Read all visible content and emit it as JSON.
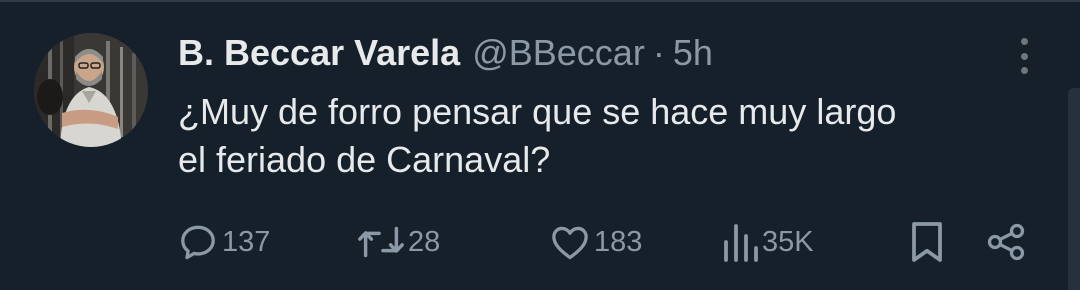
{
  "tweet": {
    "display_name": "B. Beccar Varela",
    "handle": "@BBeccar",
    "separator": "·",
    "time": "5h",
    "text_lines": [
      "¿Muy de forro pensar que se hace muy largo",
      "el feriado de Carnaval?"
    ]
  },
  "actions": {
    "reply": {
      "icon": "reply-icon",
      "count": "137"
    },
    "retweet": {
      "icon": "retweet-icon",
      "count": "28"
    },
    "like": {
      "icon": "heart-icon",
      "count": "183"
    },
    "views": {
      "icon": "views-icon",
      "count": "35K"
    },
    "bookmark": {
      "icon": "bookmark-icon"
    },
    "share": {
      "icon": "share-icon"
    }
  },
  "colors": {
    "background": "#15202b",
    "primary_text": "#e7e9ea",
    "secondary_text": "#8b98a5"
  }
}
